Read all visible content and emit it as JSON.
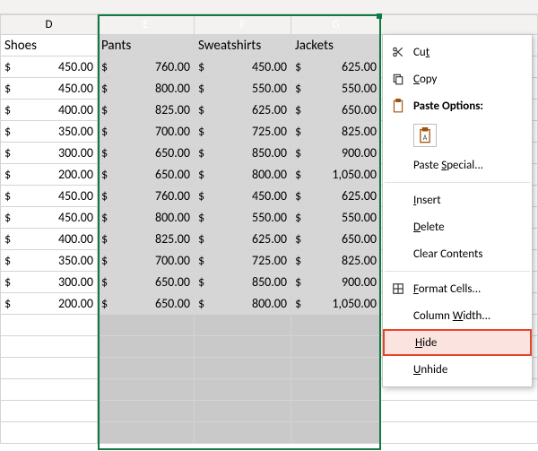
{
  "columns": {
    "D": "D",
    "E": "E",
    "F": "F",
    "G": "G"
  },
  "headers": {
    "D": "Shoes",
    "E": "Pants",
    "F": "Sweatshirts",
    "G": "Jackets"
  },
  "currency_symbol": "$",
  "rows": [
    {
      "D": "450.00",
      "E": "760.00",
      "F": "450.00",
      "G": "625.00"
    },
    {
      "D": "450.00",
      "E": "800.00",
      "F": "550.00",
      "G": "550.00"
    },
    {
      "D": "400.00",
      "E": "825.00",
      "F": "625.00",
      "G": "650.00"
    },
    {
      "D": "350.00",
      "E": "700.00",
      "F": "725.00",
      "G": "825.00"
    },
    {
      "D": "300.00",
      "E": "650.00",
      "F": "850.00",
      "G": "900.00"
    },
    {
      "D": "200.00",
      "E": "650.00",
      "F": "800.00",
      "G": "1,050.00"
    },
    {
      "D": "450.00",
      "E": "760.00",
      "F": "450.00",
      "G": "625.00"
    },
    {
      "D": "450.00",
      "E": "800.00",
      "F": "550.00",
      "G": "550.00"
    },
    {
      "D": "400.00",
      "E": "825.00",
      "F": "625.00",
      "G": "650.00"
    },
    {
      "D": "350.00",
      "E": "700.00",
      "F": "725.00",
      "G": "825.00"
    },
    {
      "D": "300.00",
      "E": "650.00",
      "F": "850.00",
      "G": "900.00"
    },
    {
      "D": "200.00",
      "E": "650.00",
      "F": "800.00",
      "G": "1,050.00"
    }
  ],
  "empty_rows": 6,
  "context_menu": {
    "cut": "Cut",
    "copy": "Copy",
    "paste_options": "Paste Options:",
    "paste_special": "Paste Special...",
    "insert": "Insert",
    "delete": "Delete",
    "clear_contents": "Clear Contents",
    "format_cells": "Format Cells...",
    "column_width": "Column Width...",
    "hide": "Hide",
    "unhide": "Unhide"
  },
  "mnemonics": {
    "cut": "t",
    "copy": "C",
    "paste_special": "S",
    "insert": "I",
    "delete": "D",
    "clear_contents": "N",
    "format_cells": "F",
    "column_width": "W",
    "hide": "H",
    "unhide": "U"
  }
}
